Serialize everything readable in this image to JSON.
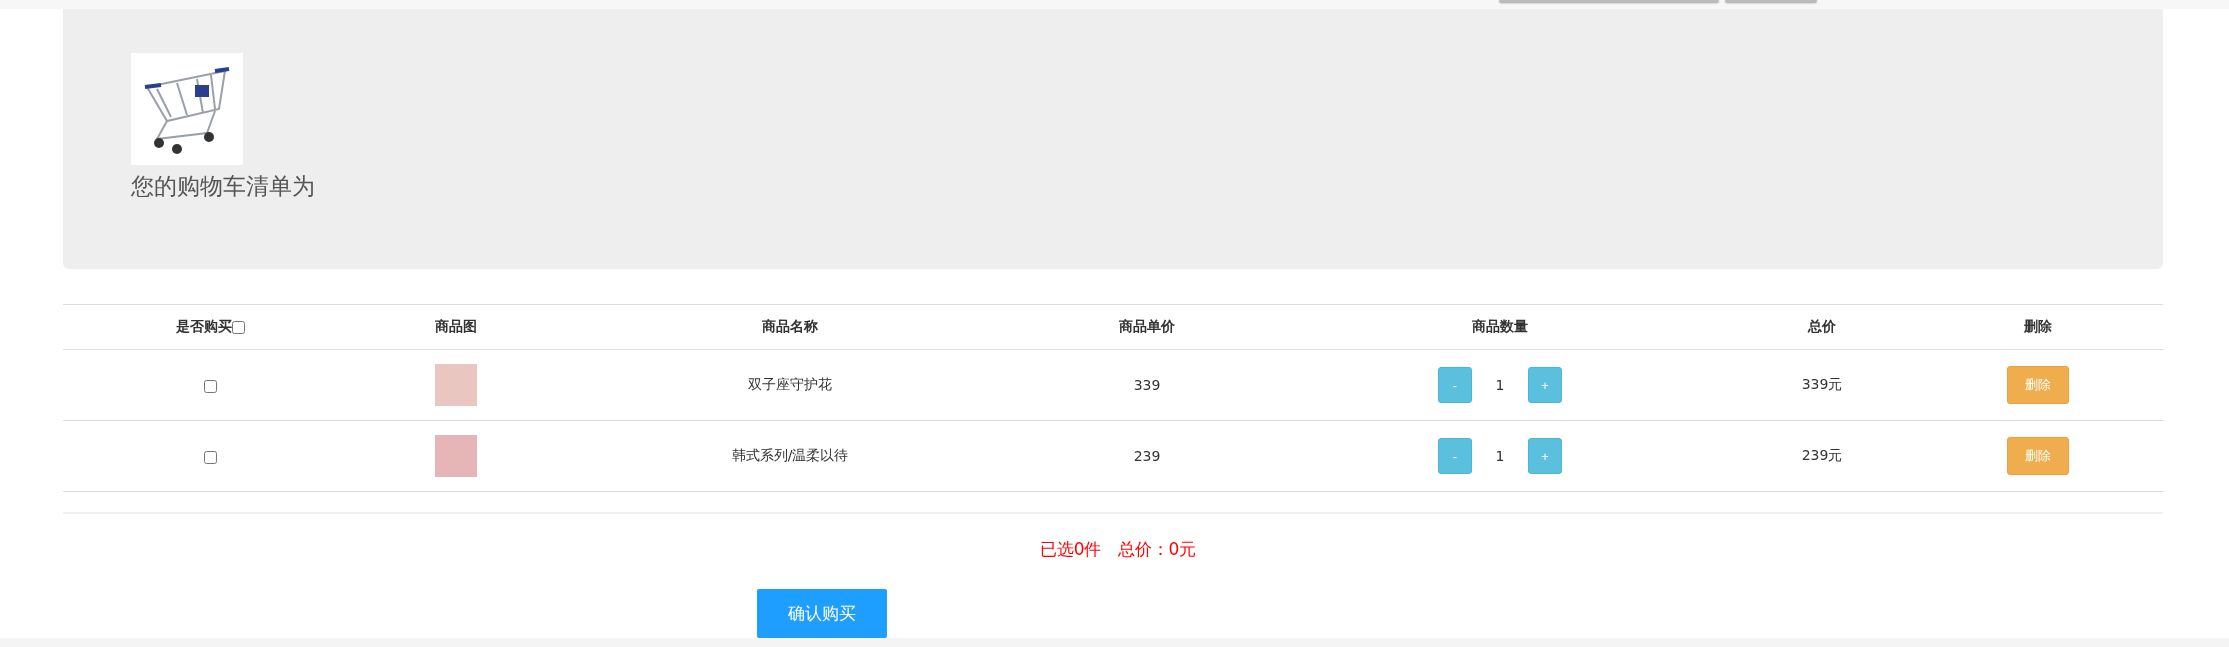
{
  "header": {
    "title": "您的购物车清单为"
  },
  "table": {
    "columns": [
      "是否购买",
      "商品图",
      "商品名称",
      "商品单价",
      "商品数量",
      "总价",
      "删除"
    ],
    "select_all": {
      "checked": false
    },
    "rows": [
      {
        "checked": false,
        "name": "双子座守护花",
        "price": "339",
        "minus": "-",
        "quantity": "1",
        "plus": "+",
        "total": "339元",
        "delete": "删除"
      },
      {
        "checked": false,
        "name": "韩式系列/温柔以待",
        "price": "239",
        "minus": "-",
        "quantity": "1",
        "plus": "+",
        "total": "239元",
        "delete": "删除"
      }
    ]
  },
  "summary": {
    "selected": "已选0件",
    "total": "总价：0元"
  },
  "confirm_button": "确认购买"
}
